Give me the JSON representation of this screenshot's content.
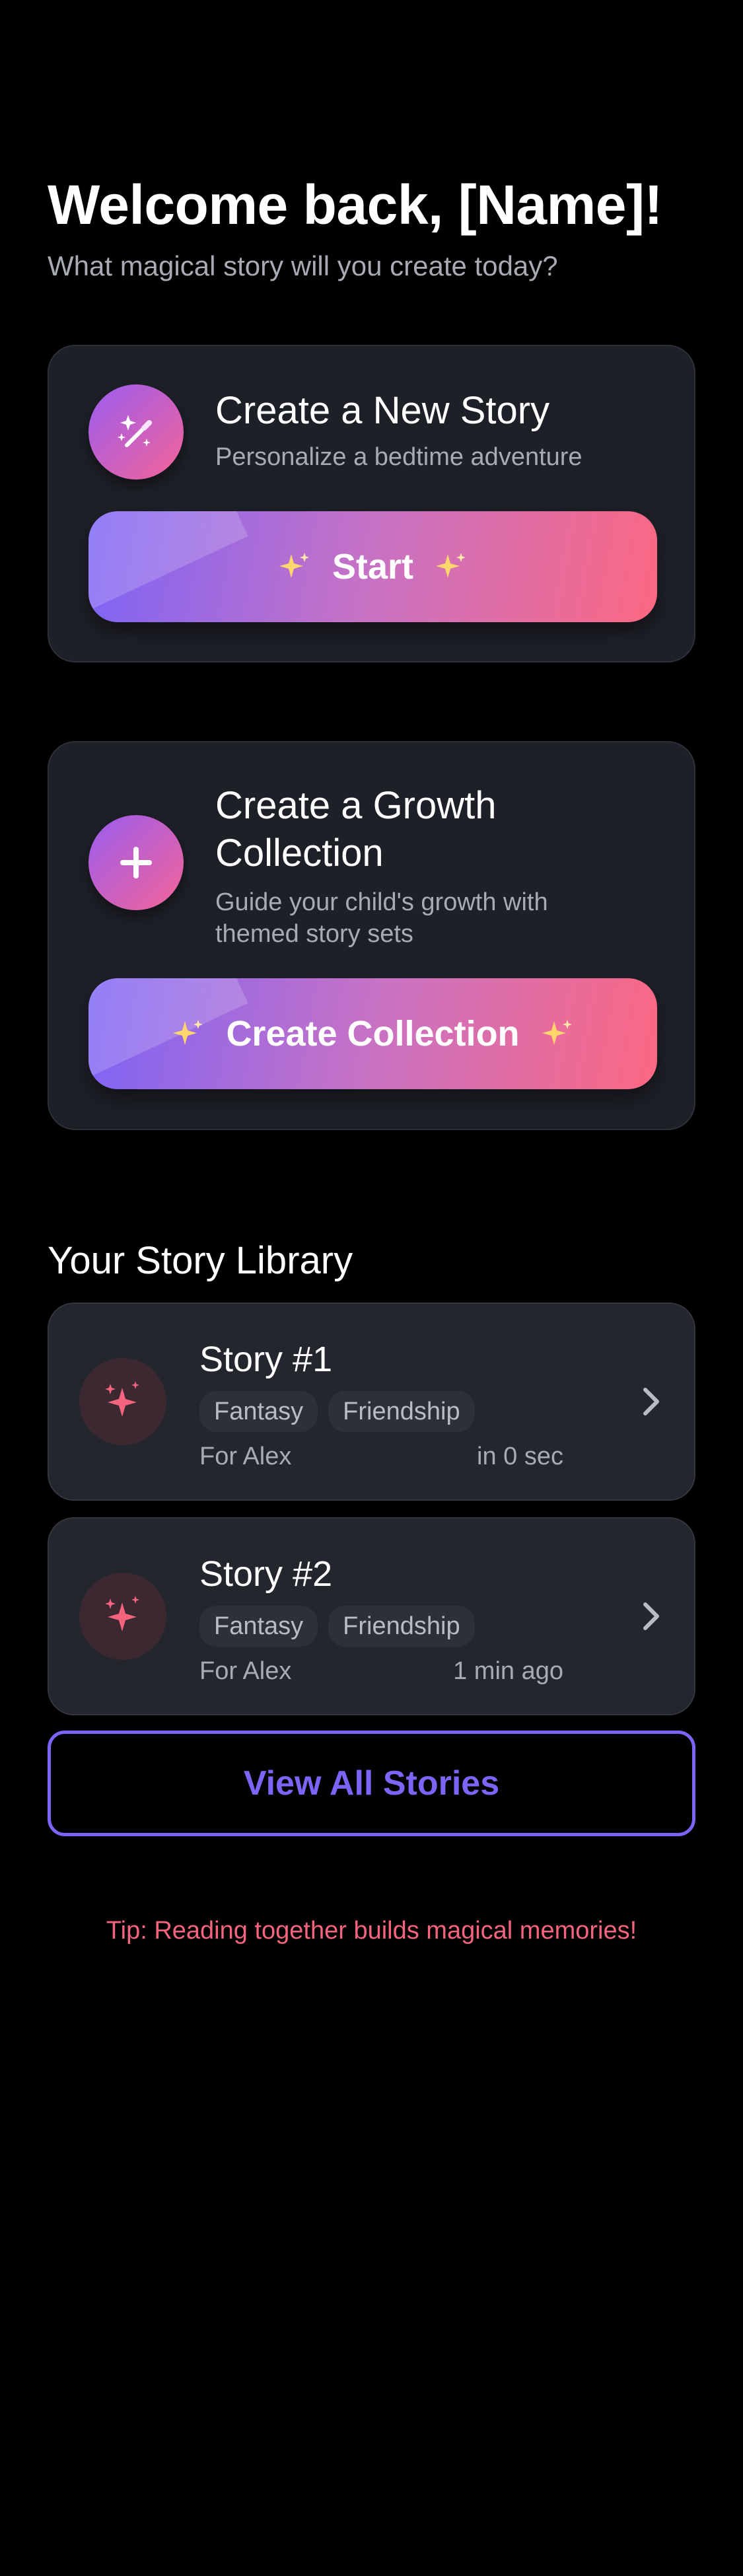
{
  "header": {
    "title": "Welcome back, [Name]!",
    "subtitle": "What magical story will you create today?"
  },
  "new_story_card": {
    "icon": "magic-wand-icon",
    "title": "Create a New Story",
    "subtitle": "Personalize a bedtime adventure",
    "button_label": "Start"
  },
  "collection_card": {
    "icon": "plus-icon",
    "title": "Create a Growth Collection",
    "subtitle": "Guide your child's growth with themed story sets",
    "button_label": "Create Collection"
  },
  "library": {
    "title": "Your Story Library",
    "stories": [
      {
        "title": "Story #1",
        "tags": [
          "Fantasy",
          "Friendship"
        ],
        "for": "For Alex",
        "time": "in 0 sec"
      },
      {
        "title": "Story #2",
        "tags": [
          "Fantasy",
          "Friendship"
        ],
        "for": "For Alex",
        "time": "1 min ago"
      }
    ],
    "view_all_label": "View All Stories"
  },
  "tip": "Tip: Reading together builds magical memories!",
  "colors": {
    "accent_purple": "#7c64f6",
    "accent_pink": "#fb6882",
    "card_bg": "#1e2028",
    "muted_text": "#a8abb3"
  }
}
